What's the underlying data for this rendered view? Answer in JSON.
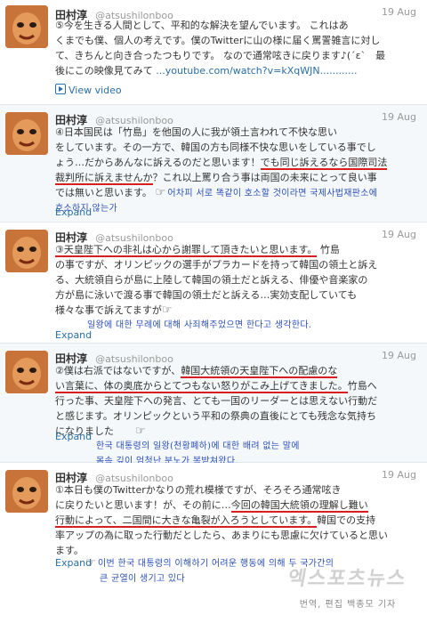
{
  "colors": {
    "link": "#2a6ea6",
    "underline": "#d81e1e",
    "korean": "#2b4fb8"
  },
  "tweets": [
    {
      "name": "田村淳",
      "handle": "@atsushilonboo",
      "date": "19 Aug",
      "lines": [
        "⑤今を生きる人間として、平和的な解決を望んでいます。 これはあ",
        "くまでも僕、個人の考えです。僕のTwitterに山の様に届く罵詈雑言に対し",
        "て、きちんと向き合ったつもりです。 なので通常呟きに戻ります♪(´ε`　最",
        "後にこの映像見てみて "
      ],
      "link": "...youtube.com/watch?v=kXqWJN............",
      "action": "View video"
    },
    {
      "name": "田村淳",
      "handle": "@atsushilonboo",
      "date": "19 Aug",
      "lines": [
        "④日本国民は「竹島」を他国の人に我が領土言われて不快な思い",
        "をしています。その一方で、韓国の方も同様不快な思いをしている事でし",
        "ょう…だからあんなに訴えるのだと思います！"
      ],
      "line3_red": "でも同じ訴えるなら国際司法",
      "line4_red": "裁判所に訴えませんか",
      "line4_rest": "？これ以上罵り合う事は両国の未来にとって良い事",
      "line5": "では無いと思います。",
      "korean_a": "어차피 서로 똑같이 호소할 것이라면 국제사법재판소에",
      "korean_b": "호소하지 않는가",
      "action": "Expand"
    },
    {
      "name": "田村淳",
      "handle": "@atsushilonboo",
      "date": "19 Aug",
      "line1_red": "③天皇陛下への非礼は心から謝罪して頂きたいと思います。",
      "line1_rest": " 竹島",
      "lines": [
        "の事ですが、オリンピックの選手がプラカードを持って韓国の領土と訴え",
        "る、大統領自らが島に上陸して韓国の領土だと訴える、俳優や音楽家の",
        "方が島に泳いで渡る事で韓国の領土だと訴える…実効支配していても",
        "様々な事で訴えてますが"
      ],
      "korean_a": "일왕에 대한 무례에 대해 사죄해주었으면 한다고 생각한다.",
      "action": "Expand"
    },
    {
      "name": "田村淳",
      "handle": "@atsushilonboo",
      "date": "19 Aug",
      "line1": "②僕は右派ではないですが、",
      "line1_red": "韓国大統領の天皇陛下への配慮のな",
      "line2_red": "い言葉に、体の奥底からとてつもない怒りがこみ上げてきました。",
      "line2_rest": "竹島へ",
      "lines": [
        "行った事、天皇陛下への発言、とても一国のリーダーとは思えない行動だ",
        "と感じます。オリンピックという平和の祭典の直後にとても残念な気持ち",
        "になりました"
      ],
      "korean_a": "한국 대통령의 일왕(천황폐하)에 대한 배려 없는 말에",
      "korean_b": "몸속 깊이 엄청난 분노가 복받쳐왔다.",
      "action": "Expand"
    },
    {
      "name": "田村淳",
      "handle": "@atsushilonboo",
      "date": "19 Aug",
      "lines": [
        "①本日も僕のTwitterかなりの荒れ模様ですが、そろそろ通常呟き"
      ],
      "line2": "に戻りたいと思います！が、その前に…",
      "line2_red": "今回の韓国大統領の理解し難い",
      "line3_red": "行動によって、二国間に大きな亀裂が入ろうとしています。",
      "line3_rest": "韓国での支持",
      "line4": "率アップの為に取った行動だとしたら、あまりにも思慮に欠けていると思い",
      "line5": "ます。",
      "korean_a": "이번 한국 대통령의 이해하기 어려운 행동에 의해 두 국가간의",
      "korean_b": "큰 균열이 생기고 있다",
      "action": "Expand"
    }
  ],
  "watermark": {
    "logo": "엑스포츠뉴스",
    "credit": "번역, 편집 백종모 기자"
  }
}
